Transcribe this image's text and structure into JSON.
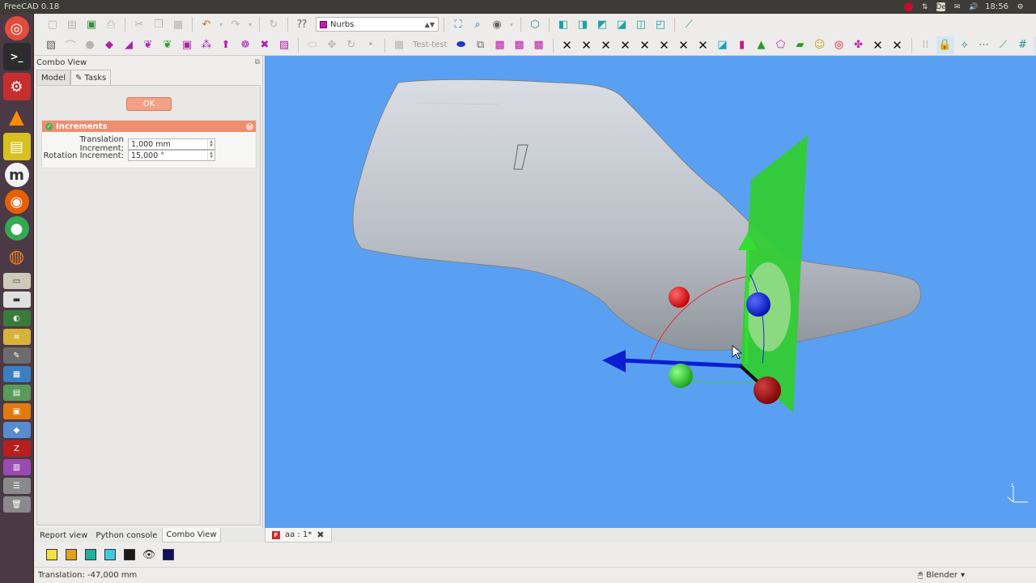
{
  "window": {
    "title": "FreeCAD 0.18"
  },
  "system_tray": {
    "time": "18:56",
    "keyboard_layout": "De"
  },
  "launcher": {
    "items": [
      "ubuntu-dash",
      "terminal",
      "freecad",
      "vlc",
      "ruler",
      "moodle",
      "firefox",
      "chrome",
      "blender",
      "files",
      "app-1",
      "app-2",
      "app-3",
      "app-4",
      "app-5",
      "app-6",
      "app-7",
      "filezilla",
      "app-9",
      "app-10",
      "trash"
    ]
  },
  "toolbar_top": {
    "workbench": "Nurbs"
  },
  "toolbar_second": {
    "test_label": "Test-test",
    "x_button_count": 8
  },
  "combo_view": {
    "title": "Combo View",
    "tabs": [
      {
        "label": "Model"
      },
      {
        "label": "Tasks"
      }
    ],
    "ok_label": "OK",
    "increments": {
      "title": "Increments",
      "translation_label": "Translation Increment:",
      "translation_value": "1,000 mm",
      "rotation_label": "Rotation Increment:",
      "rotation_value": "15,000 °"
    }
  },
  "bottom_tabs": [
    {
      "label": "Report view"
    },
    {
      "label": "Python console"
    },
    {
      "label": "Combo View"
    }
  ],
  "document_tab": {
    "label": "aa : 1*"
  },
  "status": {
    "message": "Translation: -47,000 mm",
    "navigation_style": "Blender"
  },
  "colors": {
    "viewport_bg": "#5aa0f2",
    "launcher_bg": "#4b3a45",
    "accent_orange": "#ef8d6f",
    "plane_green": "#33cc33",
    "axis_blue": "#0a1fd0",
    "sphere_red": "#e01010"
  }
}
